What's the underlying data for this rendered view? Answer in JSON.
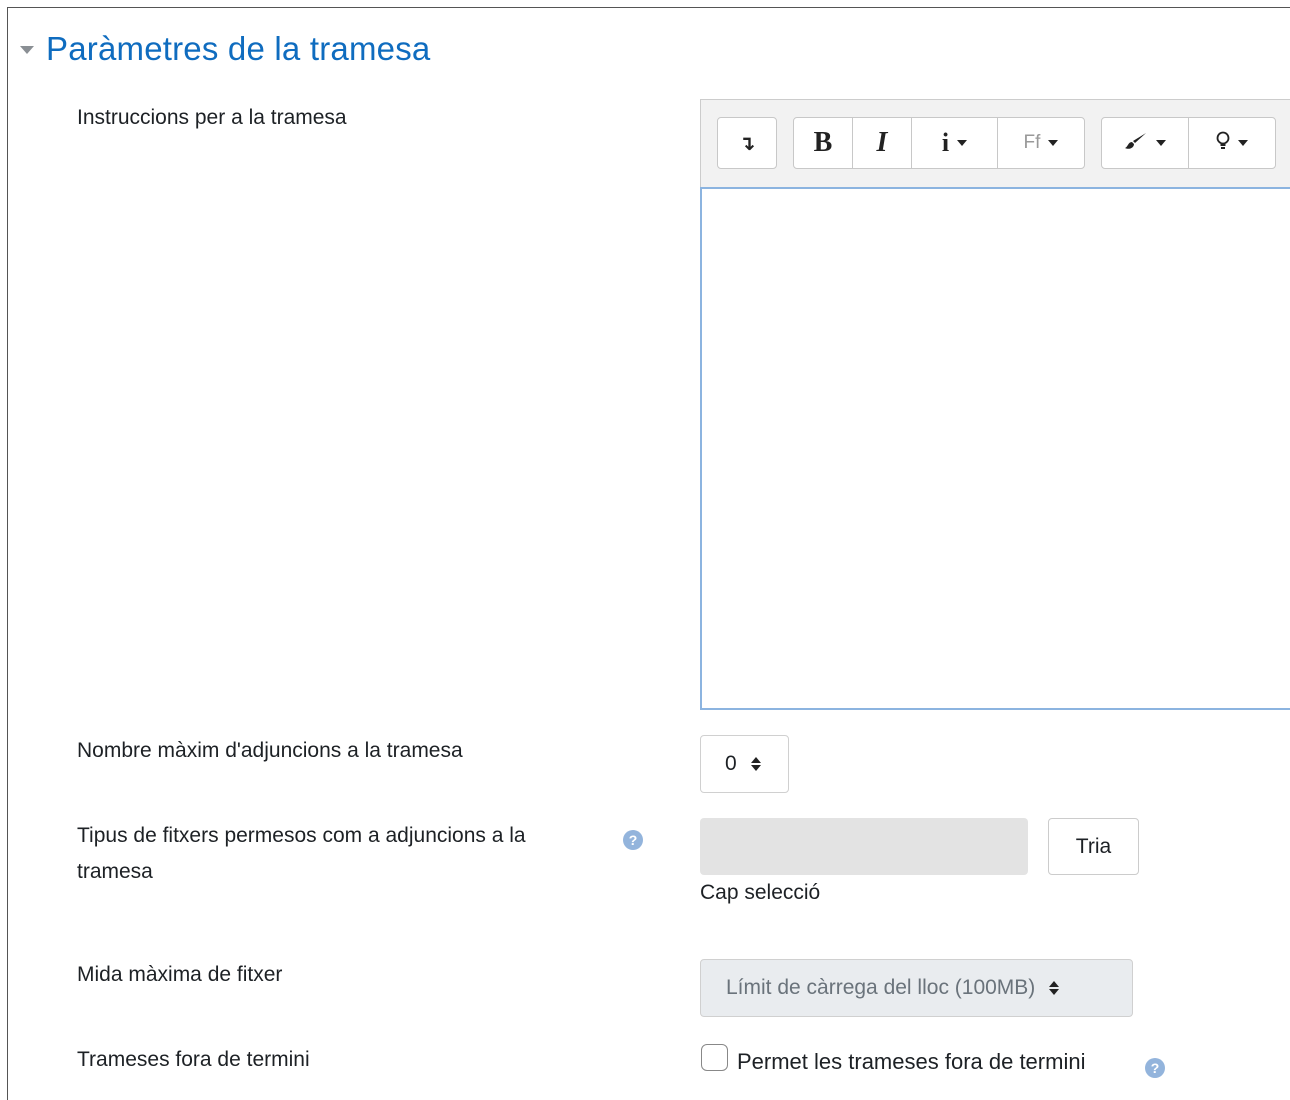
{
  "section": {
    "title": "Paràmetres de la tramesa"
  },
  "instructions": {
    "label": "Instruccions per a la tramesa"
  },
  "toolbar": {
    "expand_icon": "↴",
    "bold": "B",
    "italic": "I",
    "info": "i",
    "font": "Ff",
    "brush_icon": "paintbrush-icon",
    "bulb_icon": "lightbulb-icon"
  },
  "max_attachments": {
    "label": "Nombre màxim d'adjuncions a la tramesa",
    "value": "0"
  },
  "file_types": {
    "label_line1": "Tipus de fitxers permesos com a adjuncions a la",
    "label_line2": "tramesa",
    "button": "Tria",
    "status": "Cap selecció"
  },
  "max_size": {
    "label": "Mida màxima de fitxer",
    "value": "Límit de càrrega del lloc (100MB)"
  },
  "late": {
    "label": "Trameses fora de termini",
    "checkbox_label": "Permet les trameses fora de termini"
  },
  "colors": {
    "accent": "#0f6cbf",
    "help": "#93b4dc",
    "focus_border": "#8cb4e0"
  }
}
